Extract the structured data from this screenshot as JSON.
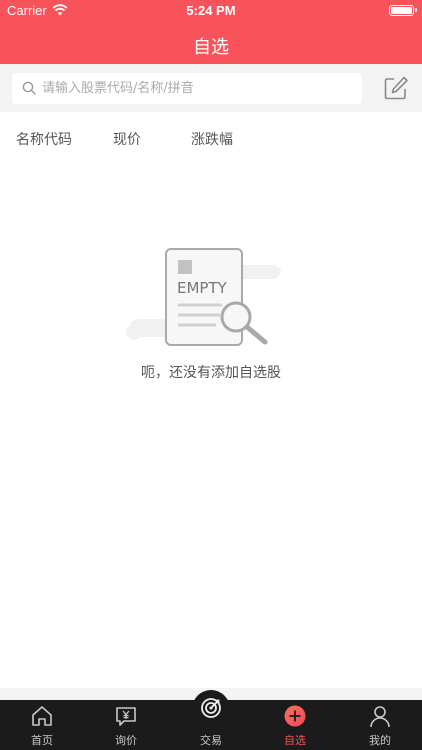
{
  "status_bar": {
    "carrier": "Carrier",
    "time": "5:24 PM"
  },
  "header": {
    "title": "自选"
  },
  "search": {
    "placeholder": "请输入股票代码/名称/拼音"
  },
  "columns": [
    "名称代码",
    "现价",
    "涨跌幅"
  ],
  "empty": {
    "badge": "EMPTY",
    "message": "呃，还没有添加自选股"
  },
  "tabs": [
    {
      "label": "首页",
      "icon": "home-icon",
      "active": false
    },
    {
      "label": "询价",
      "icon": "price-inquiry-icon",
      "active": false
    },
    {
      "label": "交易",
      "icon": "trade-target-icon",
      "active": false
    },
    {
      "label": "自选",
      "icon": "add-favorite-icon",
      "active": true
    },
    {
      "label": "我的",
      "icon": "profile-icon",
      "active": false
    }
  ],
  "colors": {
    "accent": "#f8535a",
    "tab_bar": "#1b1b1b"
  }
}
